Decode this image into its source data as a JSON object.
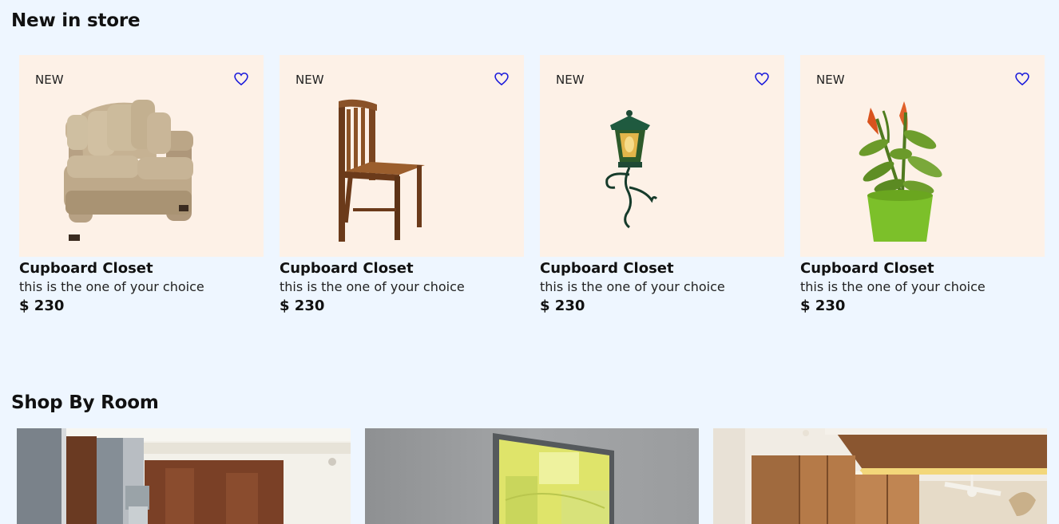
{
  "sections": {
    "new_in_store": {
      "title": "New in store"
    },
    "shop_by_room": {
      "title": "Shop By Room"
    }
  },
  "products": [
    {
      "badge": "NEW",
      "name": "Cupboard Closet",
      "description": "this is the one of your choice",
      "price": "$ 230",
      "image": "sofa"
    },
    {
      "badge": "NEW",
      "name": "Cupboard Closet",
      "description": "this is the one of your choice",
      "price": "$ 230",
      "image": "chair"
    },
    {
      "badge": "NEW",
      "name": "Cupboard Closet",
      "description": "this is the one of your choice",
      "price": "$ 230",
      "image": "lantern"
    },
    {
      "badge": "NEW",
      "name": "Cupboard Closet",
      "description": "this is the one of your choice",
      "price": "$ 230",
      "image": "potted-plant"
    }
  ],
  "rooms": [
    {
      "image": "kitchen"
    },
    {
      "image": "wall-art"
    },
    {
      "image": "wardrobe"
    }
  ],
  "colors": {
    "page_background": "#eef6ff",
    "card_background": "#fdf1e7",
    "heart_icon": "#1a1adb"
  }
}
